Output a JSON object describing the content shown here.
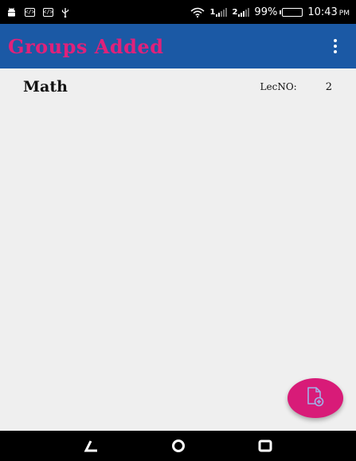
{
  "status_bar": {
    "icons_left": [
      "android-icon",
      "code-icon",
      "code-icon",
      "usb-icon"
    ],
    "sim1_label": "1",
    "sim2_label": "2",
    "battery_percent": "99%",
    "battery_level": 0.99,
    "time": "10:43",
    "time_suffix": "PM"
  },
  "app_bar": {
    "title": "Groups Added",
    "title_color": "#e0217a",
    "background": "#1b59a5",
    "menu_icon": "overflow-menu-icon"
  },
  "groups": [
    {
      "name": "Math",
      "lec_label": "LecNO:",
      "lec_value": "2"
    }
  ],
  "fab": {
    "icon": "add-file-icon",
    "color": "#d81b78"
  },
  "nav_bar": {
    "icons": [
      "back-icon",
      "home-icon",
      "recents-icon"
    ]
  }
}
